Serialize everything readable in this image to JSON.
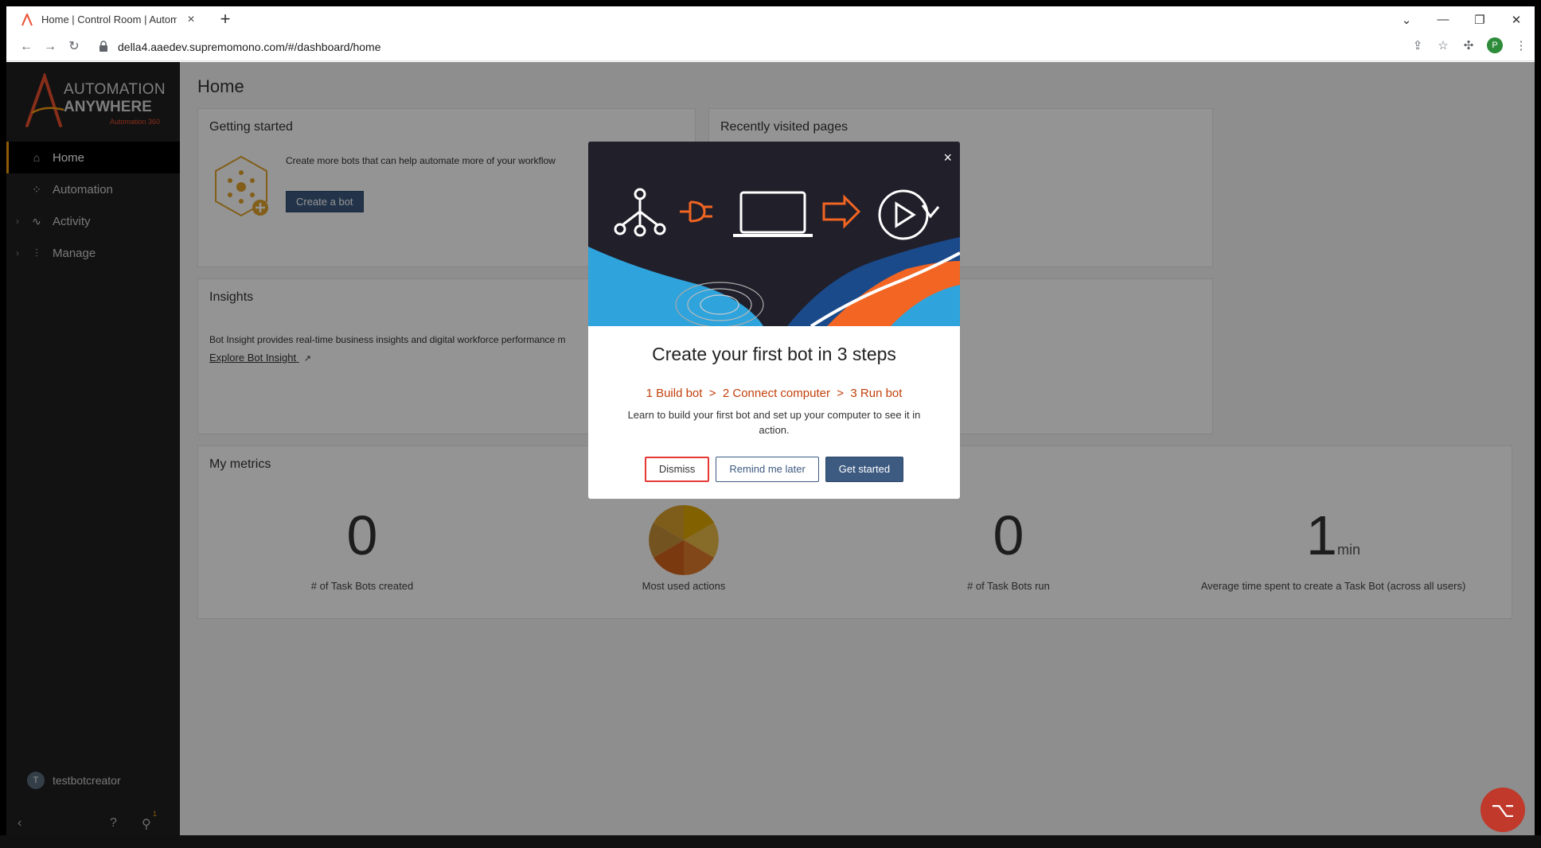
{
  "browser": {
    "tab_title": "Home | Control Room | Automat",
    "url": "della4.aaedev.supremomono.com/#/dashboard/home",
    "profile_initial": "P"
  },
  "sidebar": {
    "brand_line1": "AUTOMATION",
    "brand_line2": "ANYWHERE",
    "brand_sub": "Automation 360",
    "items": [
      {
        "label": "Home",
        "icon": "home-icon",
        "active": true
      },
      {
        "label": "Automation",
        "icon": "automation-icon",
        "active": false
      },
      {
        "label": "Activity",
        "icon": "activity-icon",
        "active": false,
        "expandable": true
      },
      {
        "label": "Manage",
        "icon": "manage-icon",
        "active": false,
        "expandable": true
      }
    ],
    "user": {
      "initial": "T",
      "name": "testbotcreator"
    },
    "notification_count": "1"
  },
  "main": {
    "page_title": "Home",
    "getting_started": {
      "title": "Getting started",
      "text": "Create more bots that can help automate more of your workflow",
      "button": "Create a bot"
    },
    "recently_visited": {
      "title": "Recently visited pages"
    },
    "insights": {
      "title": "Insights",
      "text": "Bot Insight provides real-time business insights and digital workforce performance m",
      "link": "Explore Bot Insight"
    },
    "metrics": {
      "title": "My metrics",
      "items": [
        {
          "value": "0",
          "unit": "",
          "label": "# of Task Bots created"
        },
        {
          "value": "",
          "unit": "",
          "label": "Most used actions"
        },
        {
          "value": "0",
          "unit": "",
          "label": "# of Task Bots run"
        },
        {
          "value": "1",
          "unit": "min",
          "label": "Average time spent to create a Task Bot (across all users)"
        }
      ]
    }
  },
  "modal": {
    "title": "Create your first bot in 3 steps",
    "steps": "1 Build bot  >  2 Connect computer  >  3 Run bot",
    "description": "Learn to build your first bot and set up your computer to see it in action.",
    "dismiss": "Dismiss",
    "remind": "Remind me later",
    "start": "Get started"
  },
  "colors": {
    "accent": "#3d5a80",
    "brand_orange": "#e8502f",
    "sidebar_bg": "#1f1f1f"
  }
}
